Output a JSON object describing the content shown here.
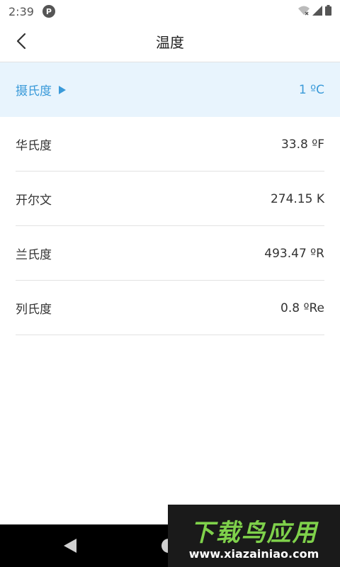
{
  "status_bar": {
    "time": "2:39",
    "app_icon_letter": "P",
    "icons": [
      "wifi-off-icon",
      "signal-icon",
      "battery-icon"
    ]
  },
  "header": {
    "title": "温度",
    "back_icon": "chevron-left-icon"
  },
  "rows": [
    {
      "label": "摄氏度",
      "value": "1 ºC",
      "selected": true
    },
    {
      "label": "华氏度",
      "value": "33.8 ºF",
      "selected": false
    },
    {
      "label": "开尔文",
      "value": "274.15 K",
      "selected": false
    },
    {
      "label": "兰氏度",
      "value": "493.47 ºR",
      "selected": false
    },
    {
      "label": "列氏度",
      "value": "0.8 ºRe",
      "selected": false
    }
  ],
  "colors": {
    "accent": "#3a9ad9",
    "selected_row_bg": "#e8f4fd",
    "divider": "#e2e2e2"
  },
  "watermark": {
    "title": "下载鸟应用",
    "url": "www.xiazainiao.com"
  }
}
